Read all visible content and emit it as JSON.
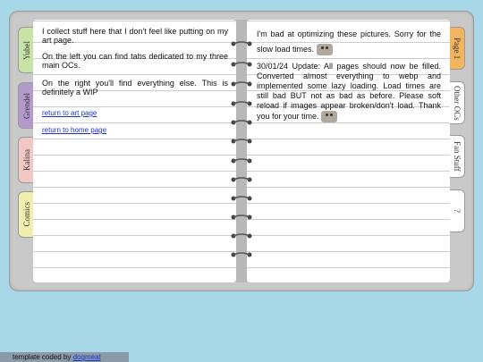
{
  "left_tabs": [
    {
      "label": "Yubel",
      "color": "#c8e3a8"
    },
    {
      "label": "Grendel",
      "color": "#b49acb"
    },
    {
      "label": "Kalina",
      "color": "#f1c9c4"
    },
    {
      "label": "Comics",
      "color": "#f1efb0"
    }
  ],
  "right_tabs": [
    {
      "label": "Page 1",
      "color": "#f2b45c"
    },
    {
      "label": "Other OCs",
      "color": "#ffffff"
    },
    {
      "label": "Fan Stuff",
      "color": "#ffffff"
    },
    {
      "label": "?",
      "color": "#ffffff"
    }
  ],
  "left_page": {
    "p1": "I collect stuff here that I don't feel like putting on my art page.",
    "p2": "On the left you can find tabs dedicated to my three main OCs.",
    "p3": "On the right you'll find everything else. This is definitely a WIP",
    "link_art": "return to art page",
    "link_home": "return to home page"
  },
  "right_page": {
    "p1": "I'm bad at optimizing these pictures. Sorry for the slow load times.",
    "p2": "30/01/24 Update: All pages should now be filled. Converted almost everything to webp and implemented some lazy loading. Load times are still bad BUT not as bad as before. Please soft reload if images appear broken/don't load. Thank you for your time."
  },
  "footer": {
    "text": "template coded by",
    "link": "dogmeat"
  }
}
